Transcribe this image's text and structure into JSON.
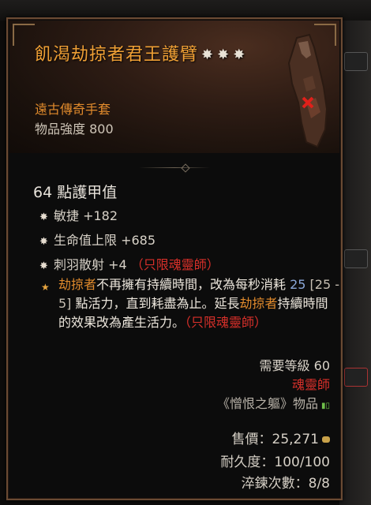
{
  "item": {
    "name": "飢渴劫掠者君王護臂",
    "rarity": "遠古傳奇手套",
    "item_power": "物品強度 800",
    "armor": "64 點護甲值",
    "affixes": [
      {
        "text": "敏捷 +182",
        "class_tag": ""
      },
      {
        "text": "生命值上限 +685",
        "class_tag": ""
      },
      {
        "text": "刺羽散射 +4",
        "class_tag": "（只限魂靈師）"
      }
    ],
    "legendary": {
      "p1": "劫掠者",
      "p2": "不再擁有持續時間，改為每秒消耗 ",
      "value": "25",
      "range": " [25 - 5] ",
      "p3": "點活力，直到耗盡為止。延長",
      "p4": "劫掠者",
      "p5": "持續時間的效果改為產生活力。",
      "class_tag": "（只限魂靈師）"
    },
    "required_level": "需要等級 60",
    "required_class": "魂靈師",
    "source": "《憎恨之軀》物品",
    "sell_price": "售價：25,271",
    "durability": "耐久度：100/100",
    "tempers": "淬鍊次數：8/8"
  }
}
